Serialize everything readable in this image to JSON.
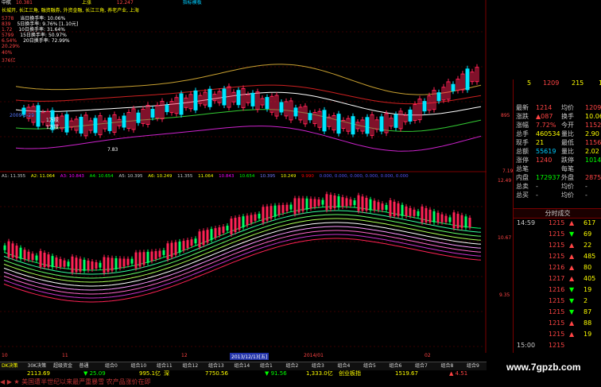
{
  "top_bar": {
    "title": "中航",
    "price": "10.381",
    "limit_up": "上涨",
    "items": [
      "12.247",
      "指标模板",
      "10.381"
    ]
  },
  "info_panel": {
    "sectors": "长城开, 长江三角, 融资融券, 外资金融, 长江三角, 养老产业, 上海",
    "turnover": [
      {
        "label": "当日换手率:",
        "value": "10.06%"
      },
      {
        "label": "5日换手率:",
        "value": "9.76% [1.10元]"
      },
      {
        "label": "10日换手率:",
        "value": "31.64%"
      },
      {
        "label": "15日换手率:",
        "value": "50.97%"
      },
      {
        "label": "20日换手率:",
        "value": "72.99%"
      }
    ],
    "left_values": [
      "5778",
      "839",
      "1.72",
      "5799",
      "6.54%",
      "20.29%",
      "40%",
      "376亿"
    ],
    "date_label": "2009-3-29",
    "note1": "1万股",
    "note2": "1万股",
    "low_mark": "7.83"
  },
  "ma_line": {
    "items": [
      {
        "label": "A1:",
        "value": "11.355",
        "color": "#cccccc"
      },
      {
        "label": "A2:",
        "value": "11.064",
        "color": "#ffff00"
      },
      {
        "label": "A3:",
        "value": "10.843",
        "color": "#ff00ff"
      },
      {
        "label": "A4:",
        "value": "10.654",
        "color": "#00ff00"
      },
      {
        "label": "A5:",
        "value": "10.395",
        "color": "#cccccc"
      },
      {
        "label": "A6:",
        "value": "10.249",
        "color": "#ffff00"
      },
      {
        "label": "",
        "value": "11.355",
        "color": "#cccccc"
      },
      {
        "label": "",
        "value": "11.064",
        "color": "#ffff00"
      },
      {
        "label": "",
        "value": "10.843",
        "color": "#ff00ff"
      },
      {
        "label": "",
        "value": "10.654",
        "color": "#00ff00"
      },
      {
        "label": "",
        "value": "10.395",
        "color": "#7777ff"
      },
      {
        "label": "",
        "value": "10.249",
        "color": "#ffff00"
      },
      {
        "label": "",
        "value": "9.990",
        "color": "#ff0000"
      },
      {
        "label": "",
        "value": "0.000, 0.000, 0.000, 0.000, 0.000, 0.000",
        "color": "#5555ff"
      }
    ]
  },
  "price_axis": {
    "top": [
      "12.49",
      "10.67",
      "9.35"
    ],
    "mid": [
      "7.19"
    ],
    "panel_top": [
      "895"
    ]
  },
  "quote_header": {
    "code": "5",
    "vol": "1209",
    "num": "215",
    "extra": "1"
  },
  "quotes": [
    {
      "l1": "最新",
      "v1": "1214",
      "l2": "均价",
      "v2": "1209",
      "c1": "#ff4444",
      "c2": "#ff4444"
    },
    {
      "l1": "涨跌",
      "v1": "▲087",
      "l2": "换手",
      "v2": "10.06%",
      "c1": "#ff4444",
      "c2": "#ffff00"
    },
    {
      "l1": "涨幅",
      "v1": "7.72%",
      "l2": "今开",
      "v2": "1152",
      "c1": "#ff4444",
      "c2": "#ff4444"
    },
    {
      "l1": "总手",
      "v1": "460534",
      "l2": "量比",
      "v2": "2.90",
      "c1": "#ffff00",
      "c2": "#ffff00"
    },
    {
      "l1": "现手",
      "v1": "21",
      "l2": "最低",
      "v2": "1156",
      "c1": "#ffff00",
      "c2": "#ff4444"
    },
    {
      "l1": "总额",
      "v1": "55619",
      "l2": "量比",
      "v2": "2.02",
      "c1": "#00ccff",
      "c2": "#ffff00"
    },
    {
      "l1": "涨停",
      "v1": "1240",
      "l2": "跌停",
      "v2": "1014",
      "c1": "#ff4444",
      "c2": "#00ff00"
    },
    {
      "l1": "总笔",
      "v1": "",
      "l2": "每笔",
      "v2": "",
      "c1": "#cccccc",
      "c2": "#cccccc"
    },
    {
      "l1": "内盘",
      "v1": "172937",
      "l2": "外盘",
      "v2": "287597",
      "c1": "#00ff00",
      "c2": "#ff4444"
    },
    {
      "l1": "总卖",
      "v1": "-",
      "l2": "均价",
      "v2": "-",
      "c1": "#cccccc",
      "c2": "#cccccc"
    },
    {
      "l1": "总买",
      "v1": "-",
      "l2": "均价",
      "v2": "-",
      "c1": "#cccccc",
      "c2": "#cccccc"
    }
  ],
  "trades_header": "分时成交",
  "trades": [
    {
      "time": "14:59",
      "price": "1215",
      "vol": "617",
      "mark": "▲",
      "mc": "#ff4444"
    },
    {
      "time": "",
      "price": "1215",
      "vol": "69",
      "mark": "▼",
      "mc": "#00ff00"
    },
    {
      "time": "",
      "price": "1215",
      "vol": "22",
      "mark": "▲",
      "mc": "#ff4444"
    },
    {
      "time": "",
      "price": "1215",
      "vol": "485",
      "mark": "▲",
      "mc": "#ff4444"
    },
    {
      "time": "",
      "price": "1216",
      "vol": "80",
      "mark": "▲",
      "mc": "#ff4444"
    },
    {
      "time": "",
      "price": "1217",
      "vol": "405",
      "mark": "▲",
      "mc": "#ff4444"
    },
    {
      "time": "",
      "price": "1216",
      "vol": "19",
      "mark": "▼",
      "mc": "#00ff00"
    },
    {
      "time": "",
      "price": "1215",
      "vol": "2",
      "mark": "▼",
      "mc": "#00ff00"
    },
    {
      "time": "",
      "price": "1215",
      "vol": "87",
      "mark": "▼",
      "mc": "#00ff00"
    },
    {
      "time": "",
      "price": "1215",
      "vol": "88",
      "mark": "▲",
      "mc": "#ff4444"
    },
    {
      "time": "",
      "price": "1215",
      "vol": "19",
      "mark": "▲",
      "mc": "#ff4444"
    },
    {
      "time": "15:00",
      "price": "1215",
      "vol": "",
      "mark": "",
      "mc": "#ff4444"
    }
  ],
  "x_axis": {
    "labels": [
      "10",
      "11",
      "12",
      "2013/12/13[五]",
      "2014/01",
      "02"
    ]
  },
  "tabs": [
    "DK决策",
    "30K决策",
    "超级资金",
    "普通",
    "组合0",
    "组合10",
    "组合11",
    "组合12",
    "组合13",
    "组合14",
    "组合1",
    "组合2",
    "组合3",
    "组合4",
    "组合5",
    "组合6",
    "组合7",
    "组合8",
    "组合9"
  ],
  "status": {
    "idx1": "2113.69",
    "chg1": "▼ 25.09",
    "amt1": "995.1亿",
    "mkt": "深",
    "idx2": "7750.56",
    "chg2": "▼ 91.56",
    "amt2": "1,333.0亿",
    "gem": "创业板指",
    "idx3": "1519.67",
    "chg3": "▲ 4.51"
  },
  "ticker": "◀ ▶ ★ 美国遭半世纪以来最严重暴雪 农产品涨价在即",
  "watermark": "www.7gpzb.com",
  "colors": {
    "up": "#ff2255",
    "down": "#00ff66",
    "grid": "#7a0000"
  }
}
